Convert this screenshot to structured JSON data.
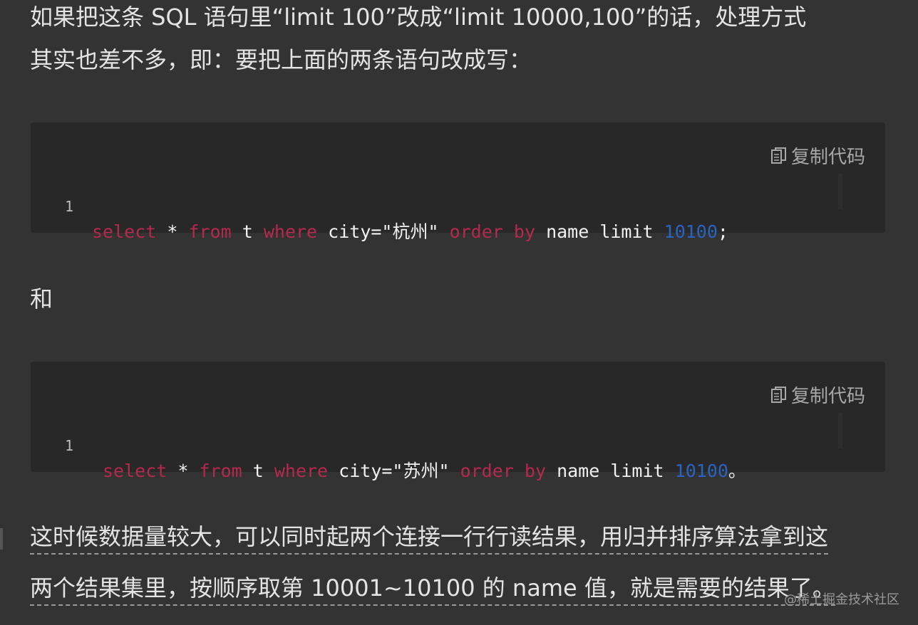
{
  "paragraphs": {
    "intro_line1": "如果把这条 SQL 语句里“limit 100”改成“limit 10000,100”的话，处理方式",
    "intro_line2": "其实也差不多，即：要把上面的两条语句改成写：",
    "and_text": "和",
    "result_line1": "这时候数据量较大，可以同时起两个连接一行行读结果，用归并排序算法拿到这",
    "result_line2": "两个结果集里，按顺序取第 10001~10100 的 name 值，就是需要的结果了。"
  },
  "code_blocks": [
    {
      "copy_label": "复制代码",
      "line_number": "1",
      "tokens": {
        "select": "select",
        "star": " * ",
        "from": "from",
        "t": " t ",
        "where": "where",
        "cond": " city=\"杭州\" ",
        "order": "order",
        "sp1": " ",
        "by": "by",
        "name_limit": " name limit ",
        "num": "10100",
        "end": ";"
      }
    },
    {
      "copy_label": "复制代码",
      "line_number": "1",
      "tokens": {
        "select": "select",
        "star": " * ",
        "from": "from",
        "t": " t ",
        "where": "where",
        "cond": " city=\"苏州\" ",
        "order": "order",
        "sp1": " ",
        "by": "by",
        "name_limit": " name limit ",
        "num": "10100",
        "end": "。"
      }
    }
  ],
  "watermark": "@稀土掘金技术社区",
  "icons": {
    "copy": "copy-icon"
  },
  "colors": {
    "background": "#333333",
    "code_background": "#282828",
    "keyword": "#b5284f",
    "number": "#2a64c0"
  }
}
